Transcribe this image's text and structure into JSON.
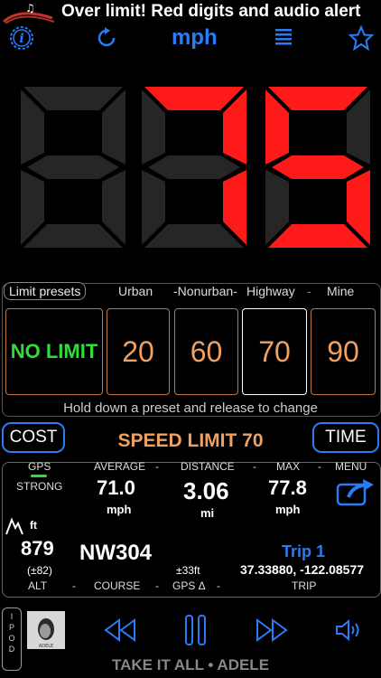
{
  "banner": {
    "text": "Over limit! Red digits and audio alert"
  },
  "toolbar": {
    "unit": "mph"
  },
  "digits": {
    "display": "075",
    "active_color": "#ff1a1a",
    "inactive_color": "#262626"
  },
  "presets": {
    "title": "Limit presets",
    "labels": [
      "Urban",
      "Nonurban",
      "Highway",
      "Mine"
    ],
    "no_limit": "NO LIMIT",
    "values": [
      "20",
      "60",
      "70",
      "90"
    ],
    "selected": "70",
    "hint": "Hold down a preset and release to change"
  },
  "limit_row": {
    "cost": "COST",
    "speed_limit": "SPEED LIMIT 70",
    "time": "TIME"
  },
  "stats": {
    "gps_label": "GPS",
    "gps_strength": "STRONG",
    "average_label": "AVERAGE",
    "average_value": "71.0",
    "average_unit": "mph",
    "distance_label": "DISTANCE",
    "distance_value": "3.06",
    "distance_unit": "mi",
    "max_label": "MAX",
    "max_value": "77.8",
    "max_unit": "mph",
    "menu_label": "MENU",
    "alt_unit": "ft",
    "alt_value": "879",
    "alt_accuracy": "(±82)",
    "heading": "NW304",
    "gps_delta_value": "±33ft",
    "trip_name": "Trip 1",
    "coords": "37.33880, -122.08577",
    "alt_label": "ALT",
    "course_label": "COURSE",
    "gps_delta_label": "GPS Δ",
    "trip_label": "TRIP"
  },
  "player": {
    "ipod_label": "IPOD",
    "album_caption": "ADELE",
    "now_playing": "TAKE IT ALL • ADELE"
  }
}
